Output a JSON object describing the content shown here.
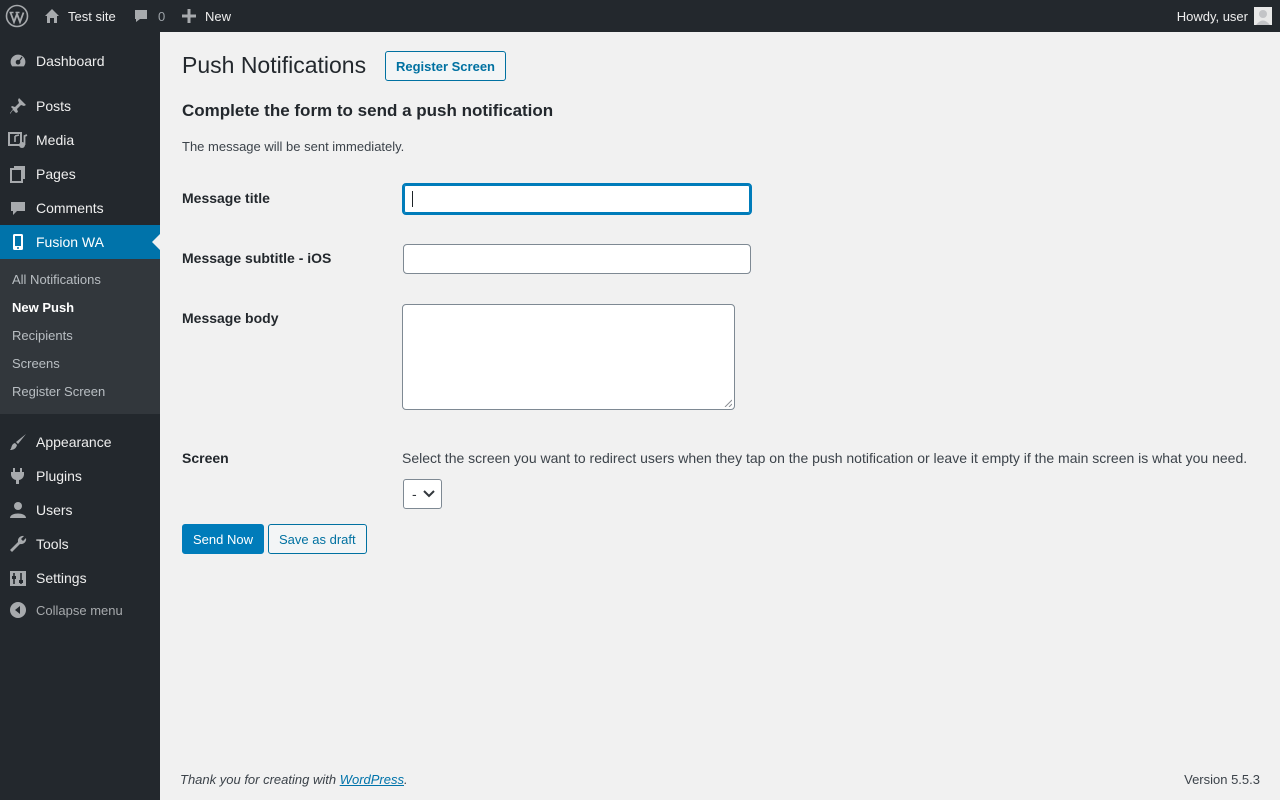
{
  "admin_bar": {
    "site_name": "Test site",
    "comments_count": "0",
    "new_label": "New",
    "howdy": "Howdy, user"
  },
  "sidebar": {
    "menu": [
      {
        "label": "Dashboard",
        "icon": "dashboard-icon"
      },
      {
        "label": "Posts",
        "icon": "pushpin-icon"
      },
      {
        "label": "Media",
        "icon": "media-icon"
      },
      {
        "label": "Pages",
        "icon": "pages-icon"
      },
      {
        "label": "Comments",
        "icon": "comment-icon"
      },
      {
        "label": "Fusion WA",
        "icon": "phone-icon",
        "current": true
      },
      {
        "label": "Appearance",
        "icon": "paintbrush-icon"
      },
      {
        "label": "Plugins",
        "icon": "plug-icon"
      },
      {
        "label": "Users",
        "icon": "user-icon"
      },
      {
        "label": "Tools",
        "icon": "wrench-icon"
      },
      {
        "label": "Settings",
        "icon": "settings-icon"
      }
    ],
    "submenu": [
      "All Notifications",
      "New Push",
      "Recipients",
      "Screens",
      "Register Screen"
    ],
    "submenu_active": "New Push",
    "collapse_label": "Collapse menu"
  },
  "page": {
    "title": "Push Notifications",
    "title_action": "Register Screen",
    "section_title": "Complete the form to send a push notification",
    "description": "The message will be sent immediately.",
    "fields": {
      "title_label": "Message title",
      "title_value": "",
      "subtitle_label": "Message subtitle - iOS",
      "subtitle_value": "",
      "body_label": "Message body",
      "body_value": "",
      "screen_label": "Screen",
      "screen_help": "Select the screen you want to redirect users when they tap on the push notification or leave it empty if the main screen is what you need.",
      "screen_selected": "-"
    },
    "buttons": {
      "send_now": "Send Now",
      "save_draft": "Save as draft"
    }
  },
  "footer": {
    "thanks_prefix": "Thank you for creating with ",
    "thanks_link": "WordPress",
    "thanks_suffix": ".",
    "version": "Version 5.5.3"
  },
  "colors": {
    "admin_dark": "#23282d",
    "submenu_bg": "#32373c",
    "accent": "#0073aa",
    "page_bg": "#f1f1f1"
  }
}
